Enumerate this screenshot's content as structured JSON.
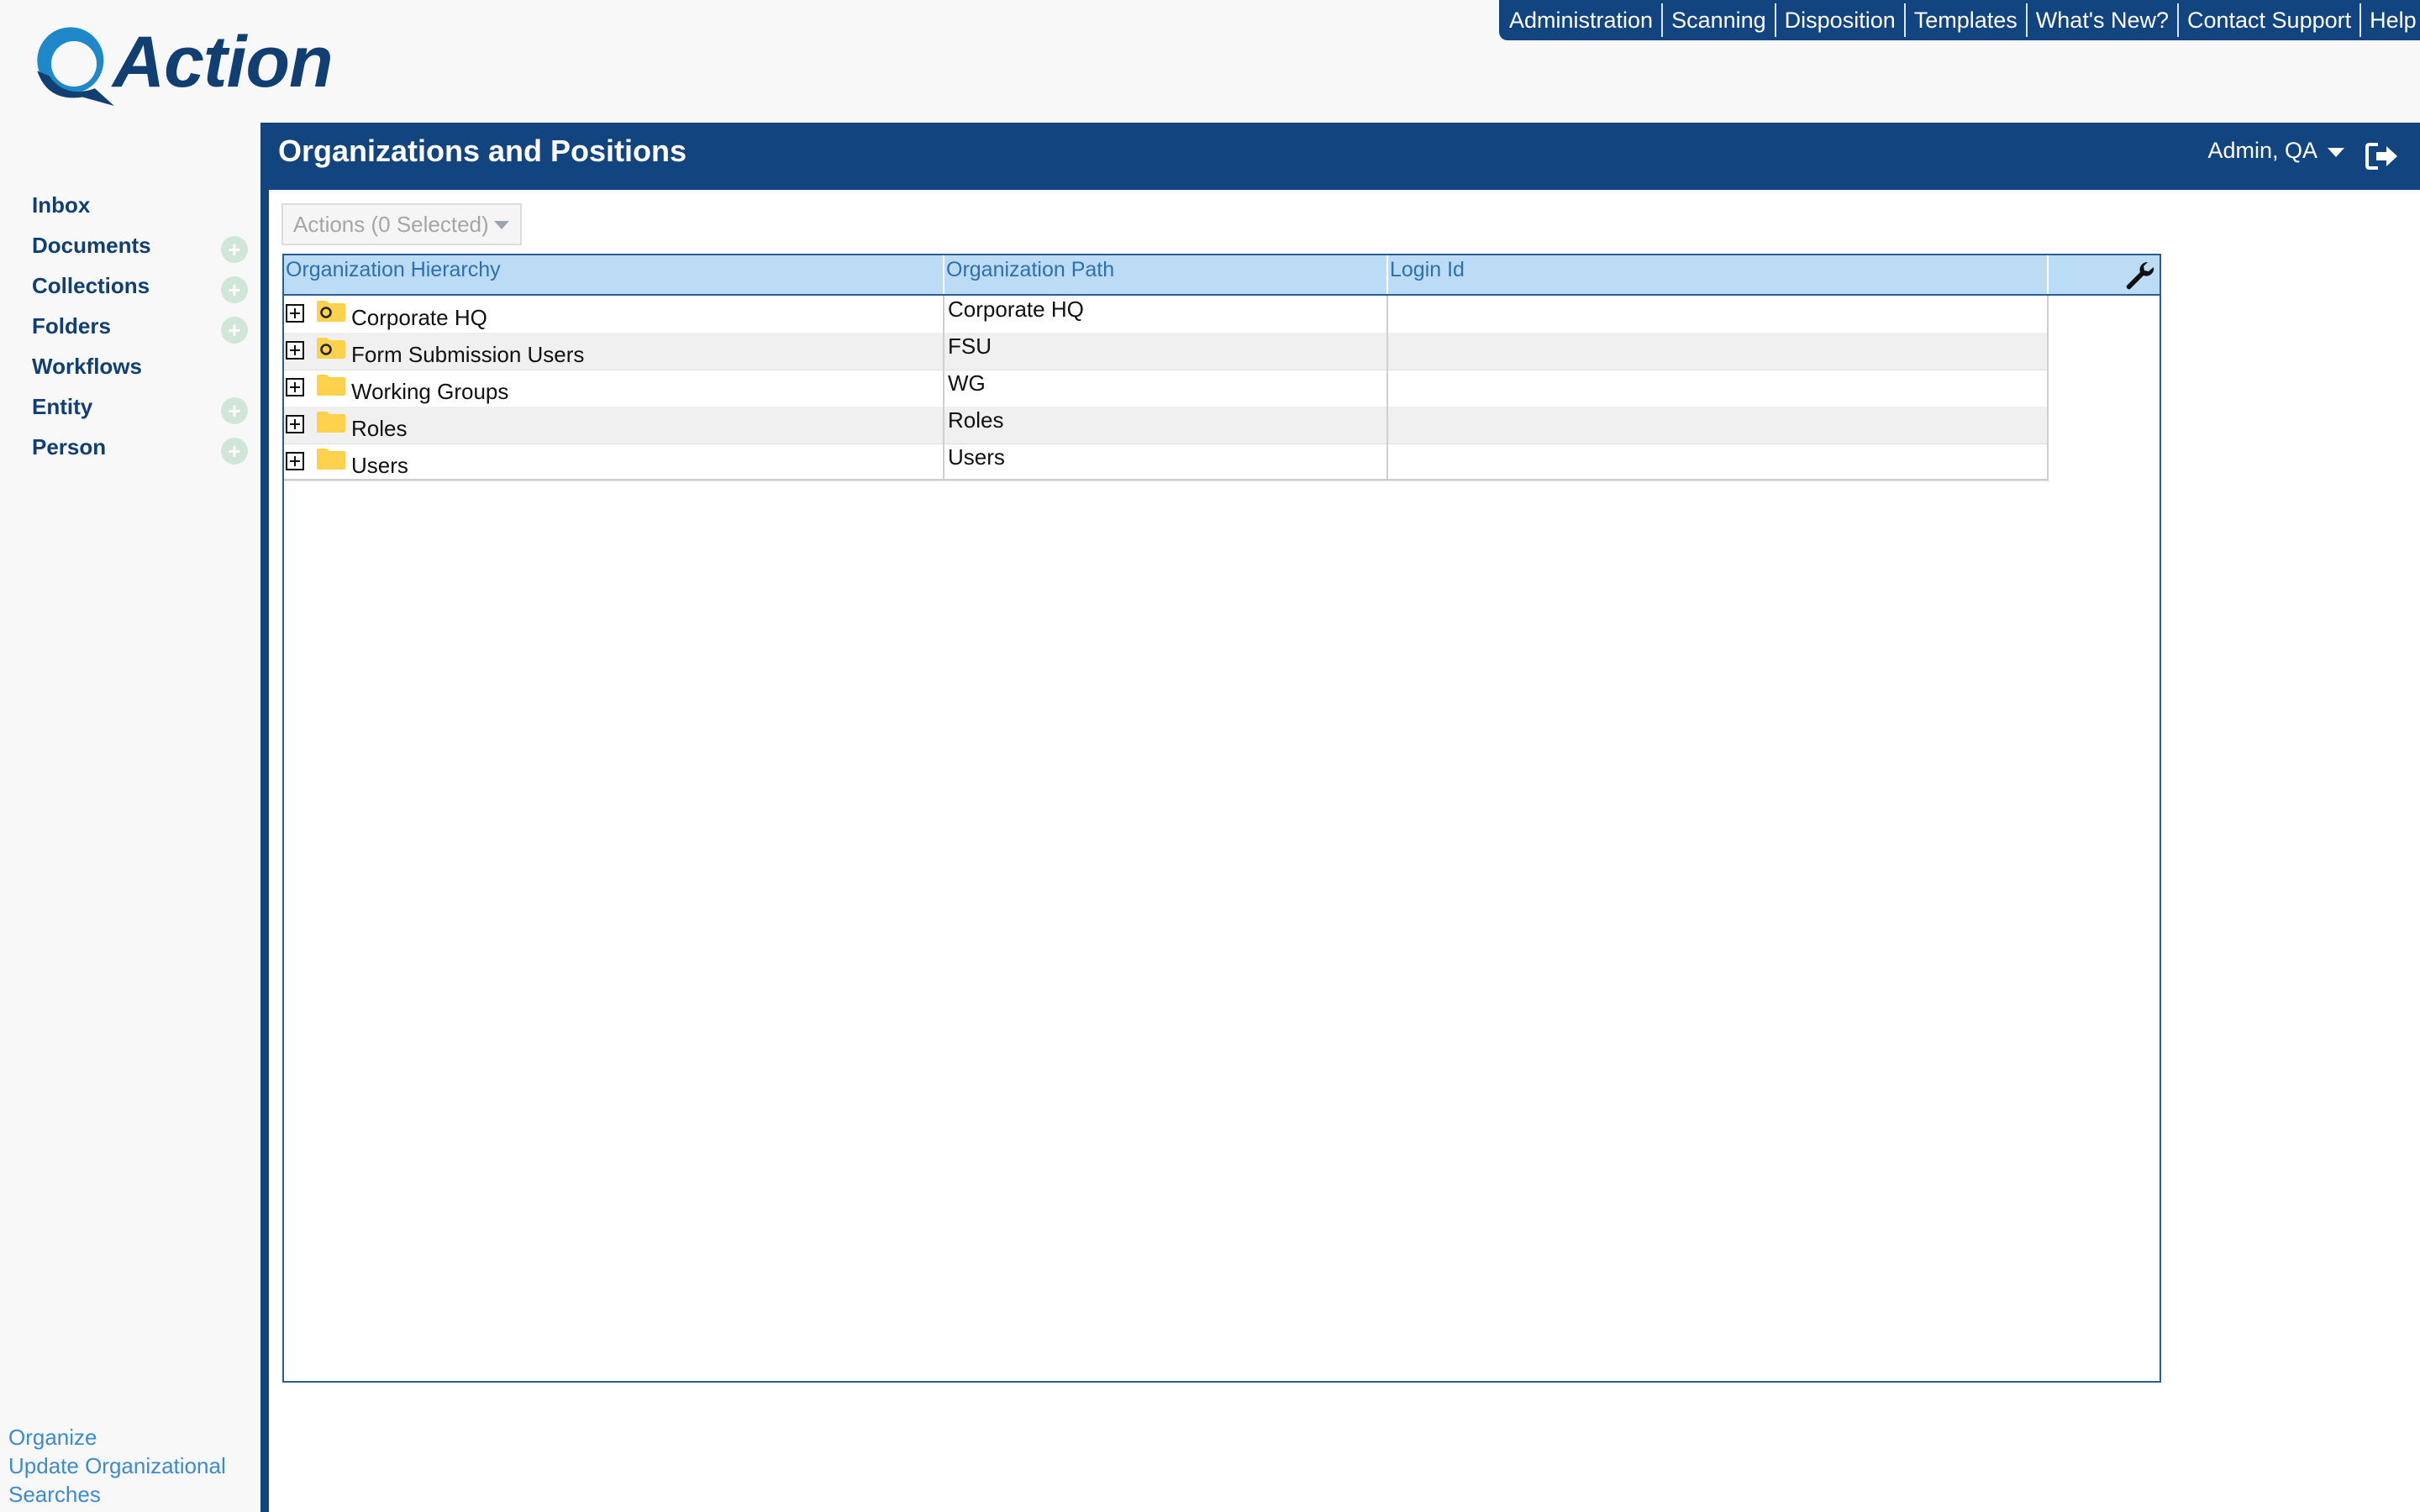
{
  "app": {
    "logo_text": "Action"
  },
  "top_links": [
    "Administration",
    "Scanning",
    "Disposition",
    "Templates",
    "What's New?",
    "Contact Support",
    "Help"
  ],
  "sidebar": {
    "items": [
      {
        "label": "Inbox",
        "has_add": false
      },
      {
        "label": "Documents",
        "has_add": true
      },
      {
        "label": "Collections",
        "has_add": true
      },
      {
        "label": "Folders",
        "has_add": true
      },
      {
        "label": "Workflows",
        "has_add": false
      },
      {
        "label": "Entity",
        "has_add": true
      },
      {
        "label": "Person",
        "has_add": true
      }
    ],
    "bottom_links": [
      "Organize",
      "Update Organizational",
      "Searches"
    ]
  },
  "header": {
    "title": "Organizations and Positions",
    "user": "Admin, QA"
  },
  "actions_button": {
    "label": "Actions (0 Selected)"
  },
  "grid": {
    "columns": [
      "Organization Hierarchy",
      "Organization Path",
      "Login Id"
    ],
    "rows": [
      {
        "name": "Corporate HQ",
        "path": "Corporate HQ",
        "login": "",
        "icon": "organization-folder-icon"
      },
      {
        "name": "Form Submission Users",
        "path": "FSU",
        "login": "",
        "icon": "organization-folder-icon"
      },
      {
        "name": "Working Groups",
        "path": "WG",
        "login": "",
        "icon": "folder-icon"
      },
      {
        "name": "Roles",
        "path": "Roles",
        "login": "",
        "icon": "folder-icon"
      },
      {
        "name": "Users",
        "path": "Users",
        "login": "",
        "icon": "folder-icon"
      }
    ]
  },
  "colors": {
    "brand": "#124580",
    "header_row": "#bcdcf5",
    "folder": "#ffd24d",
    "link": "#3e8ad2"
  }
}
